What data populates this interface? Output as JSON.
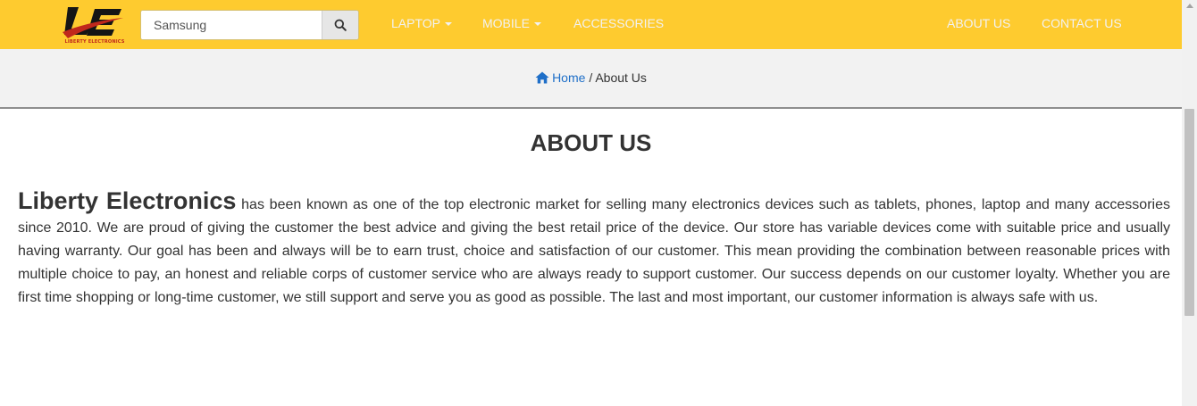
{
  "navbar": {
    "logo_text": "LIBERTY ELECTRONICS",
    "search_value": "Samsung",
    "search_icon": "search-icon",
    "items": [
      {
        "label": "LAPTOP",
        "has_dropdown": true
      },
      {
        "label": "MOBILE",
        "has_dropdown": true
      },
      {
        "label": "ACCESSORIES",
        "has_dropdown": false
      },
      {
        "label": "ABOUT US",
        "has_dropdown": false
      },
      {
        "label": "CONTACT US",
        "has_dropdown": false
      }
    ]
  },
  "breadcrumb": {
    "home_icon": "home-icon",
    "home_label": "Home",
    "separator": "/",
    "current": "About Us"
  },
  "main": {
    "title": "ABOUT US",
    "brand": "Liberty Electronics",
    "body": "has been known as one of the top electronic market for selling many electronics devices such as tablets, phones, laptop and many accessories since 2010. We are proud of giving the customer the best advice and giving the best retail price of the device. Our store has variable devices come with suitable price and usually having warranty. Our goal has been and always will be to earn trust, choice and satisfaction of our customer. This mean providing the combination between reasonable prices with multiple choice to pay, an honest and reliable corps of customer service who are always ready to support customer. Our success depends on our customer loyalty. Whether you are first time shopping or long-time customer, we still support and serve you as good as possible. The last and most important, our customer information is always safe with us."
  },
  "colors": {
    "navbar_bg": "#fecb2f",
    "nav_text": "#f2f2f2",
    "link_blue": "#1f6fc8",
    "logo_red": "#c0281c"
  }
}
